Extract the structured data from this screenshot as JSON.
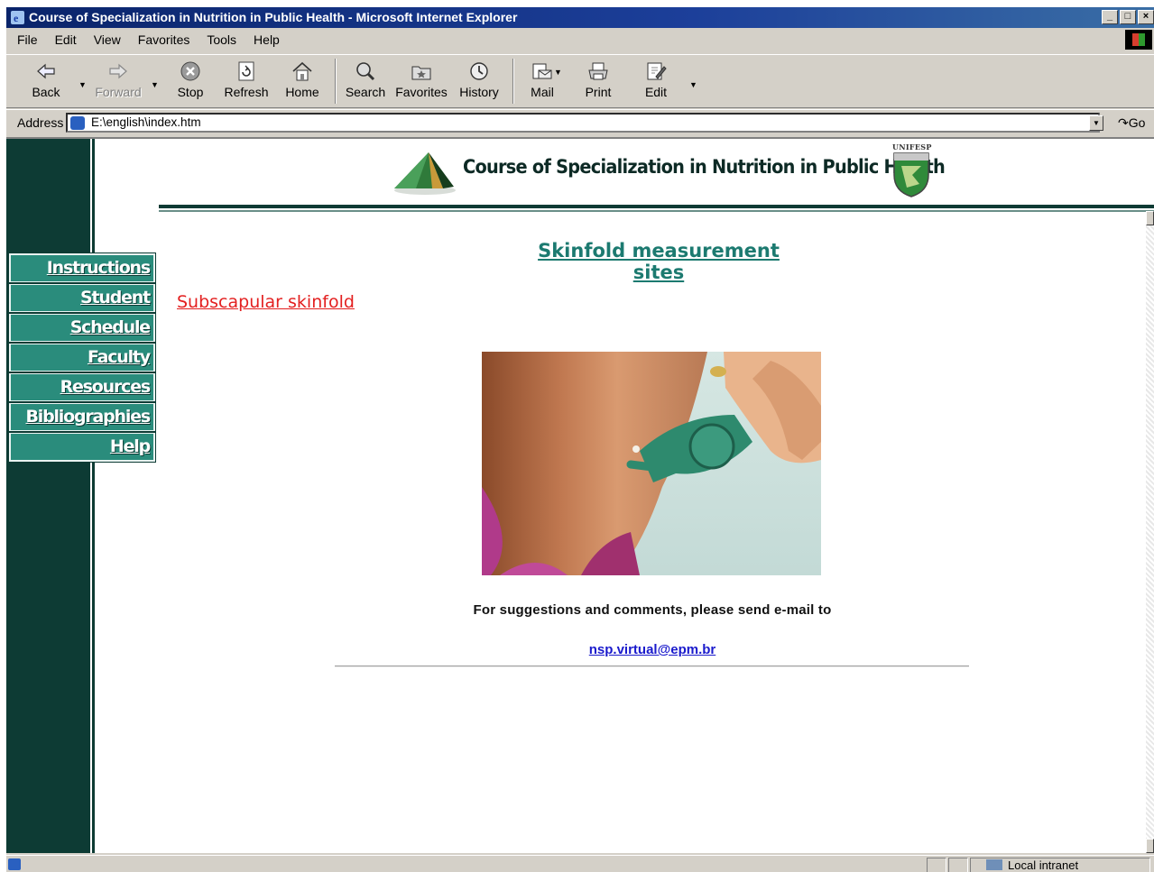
{
  "window": {
    "title": "Course of Specialization in Nutrition in Public Health - Microsoft Internet Explorer",
    "controls": [
      "minimize",
      "maximize",
      "close"
    ]
  },
  "menu": {
    "items": [
      {
        "label": "File",
        "key": "F"
      },
      {
        "label": "Edit",
        "key": "E"
      },
      {
        "label": "View",
        "key": "V"
      },
      {
        "label": "Favorites",
        "key": "a"
      },
      {
        "label": "Tools",
        "key": "T"
      },
      {
        "label": "Help",
        "key": "H"
      }
    ]
  },
  "toolbar": {
    "back": "Back",
    "forward": "Forward",
    "stop": "Stop",
    "refresh": "Refresh",
    "home": "Home",
    "search": "Search",
    "favorites": "Favorites",
    "history": "History",
    "mail": "Mail",
    "print": "Print",
    "edit": "Edit"
  },
  "address": {
    "label": "Address",
    "url": "E:\\english\\index.htm",
    "go": "Go"
  },
  "page": {
    "site_title": "Course of Specialization in Nutrition in Public Health",
    "institution_logo_text": "UNIFESP",
    "heading": "Skinfold measurement sites",
    "subheading": "Subscapular skinfold",
    "footer_text": "For suggestions and comments, please send e-mail to",
    "email": "nsp.virtual@epm.br",
    "nav": [
      "Instructions",
      "Student",
      "Schedule",
      "Faculty",
      "Resources",
      "Bibliographies",
      "Help"
    ]
  },
  "status": {
    "zone": "Local intranet"
  },
  "colors": {
    "dark_teal": "#0d3b34",
    "nav_teal": "#2a8c7c",
    "heading_teal": "#1c7a70",
    "subheading_red": "#e32020",
    "link_blue": "#1a1acc",
    "titlebar_blue": "#0a246a"
  }
}
